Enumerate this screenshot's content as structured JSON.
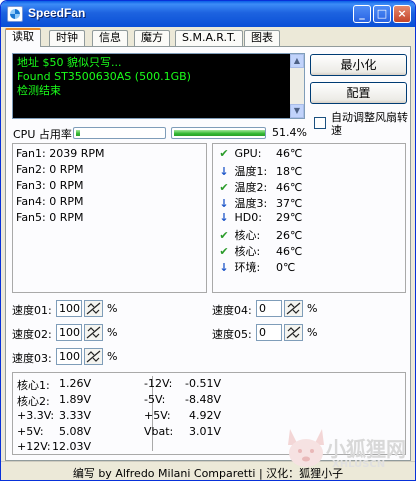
{
  "window": {
    "title": "SpeedFan"
  },
  "tabs": [
    "读取",
    "时钟",
    "信息",
    "魔方",
    "S.M.A.R.T.",
    "图表"
  ],
  "log_lines": [
    "地址 $50 貌似只写...",
    "Found ST3500630AS (500.1GB)",
    "检测结束"
  ],
  "buttons": {
    "minimize": "最小化",
    "config": "配置"
  },
  "auto_fan": {
    "label": "自动调整风扇转速",
    "checked": false
  },
  "cpu": {
    "label": "CPU 占用率",
    "bar1_fraction": 0.04,
    "bar2_fraction": 1.0,
    "percent": "51.4%"
  },
  "fans": [
    "Fan1: 2039 RPM",
    "Fan2: 0 RPM",
    "Fan3: 0 RPM",
    "Fan4: 0 RPM",
    "Fan5: 0 RPM"
  ],
  "temps": [
    {
      "icon": "check-icon",
      "name": "GPU:",
      "value": "46℃"
    },
    {
      "icon": "arrow-down-icon",
      "name": "温度1:",
      "value": "18℃"
    },
    {
      "icon": "check-icon",
      "name": "温度2:",
      "value": "46℃"
    },
    {
      "icon": "arrow-down-icon",
      "name": "温度3:",
      "value": "37℃"
    },
    {
      "icon": "arrow-down-icon",
      "name": "HD0:",
      "value": "29℃"
    },
    {
      "icon": "check-icon",
      "name": "核心:",
      "value": "26℃"
    },
    {
      "icon": "check-icon",
      "name": "核心:",
      "value": "46℃"
    },
    {
      "icon": "arrow-down-icon",
      "name": "环境:",
      "value": "0℃"
    }
  ],
  "speeds": [
    {
      "label": "速度01:",
      "value": "100"
    },
    {
      "label": "速度02:",
      "value": "100"
    },
    {
      "label": "速度03:",
      "value": "100"
    },
    {
      "label": "速度04:",
      "value": "0"
    },
    {
      "label": "速度05:",
      "value": "0"
    }
  ],
  "speed_unit": "%",
  "voltages_left": [
    {
      "name": "核心1:",
      "value": "1.26V"
    },
    {
      "name": "核心2:",
      "value": "1.89V"
    },
    {
      "name": "+3.3V:",
      "value": "3.33V"
    },
    {
      "name": "+5V:",
      "value": "5.08V"
    },
    {
      "name": "+12V:",
      "value": "12.03V"
    }
  ],
  "voltages_right": [
    {
      "name": "-12V:",
      "value": "-0.51V"
    },
    {
      "name": "-5V:",
      "value": "-8.48V"
    },
    {
      "name": "+5V:",
      "value": "4.92V"
    },
    {
      "name": "Vbat:",
      "value": "3.01V"
    }
  ],
  "status": "编写 by Alfredo Milani Comparetti | 汉化：狐狸小子",
  "watermark": {
    "text": "小狐狸网",
    "url": "XHLUSCN"
  }
}
